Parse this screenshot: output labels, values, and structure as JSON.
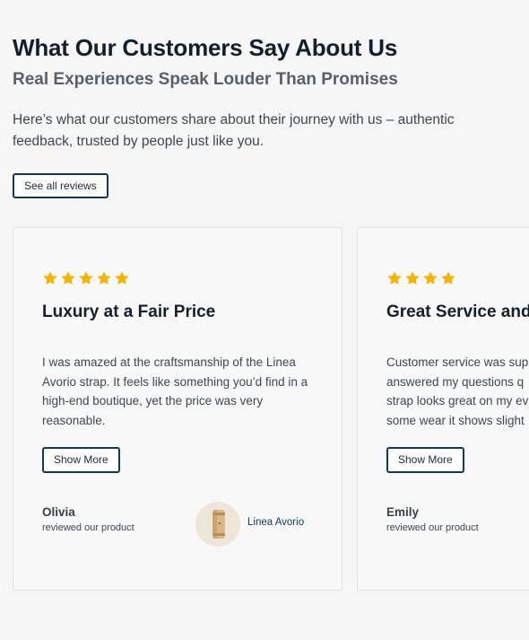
{
  "header": {
    "title": "What Our Customers Say About Us",
    "subtitle": "Real Experiences Speak Louder Than Promises",
    "intro": "Here’s what our customers share about their journey with us – authentic feedback, trusted by people just like you.",
    "see_all_label": "See all reviews"
  },
  "colors": {
    "star": "#f5b400",
    "button_border": "#0f3b52",
    "page_background": "#f6f6f6"
  },
  "reviews": [
    {
      "rating": 5,
      "title": "Luxury at a Fair Price",
      "body": "I was amazed at the craftsmanship of the Linea Avorio strap. It feels like something you’d find in a high-end boutique, yet the price was very reasonable.",
      "show_more_label": "Show More",
      "reviewer": "Olivia",
      "reviewer_note": "reviewed our product",
      "product_name": "Linea Avorio",
      "product_icon": "watch-strap-thumbnail"
    },
    {
      "rating": 4,
      "title": "Great Service and I",
      "body_lines": [
        "Customer service was sup",
        "answered my questions q",
        "strap looks great on my ev",
        "some wear it shows slight"
      ],
      "show_more_label": "Show More",
      "reviewer": "Emily",
      "reviewer_note": "reviewed our product"
    }
  ]
}
